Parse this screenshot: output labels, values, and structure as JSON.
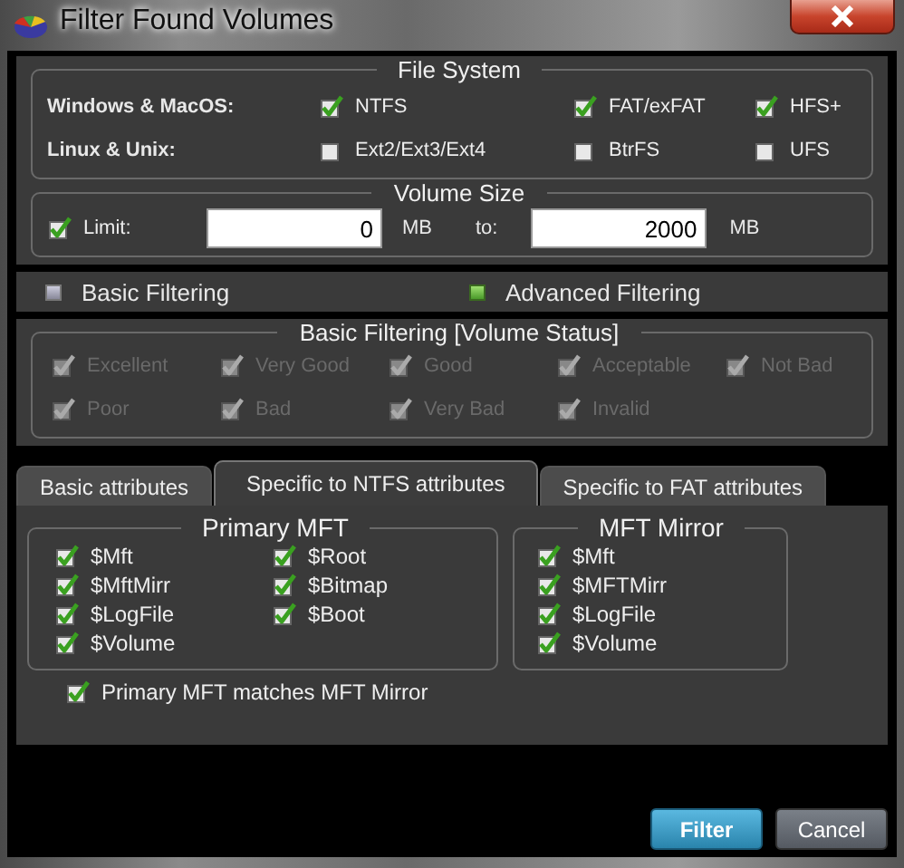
{
  "window": {
    "title": "Filter Found Volumes"
  },
  "file_system": {
    "title": "File System",
    "rows": [
      {
        "label": "Windows & MacOS:",
        "options": [
          {
            "label": "NTFS",
            "checked": true
          },
          {
            "label": "FAT/exFAT",
            "checked": true
          },
          {
            "label": "HFS+",
            "checked": true
          }
        ]
      },
      {
        "label": "Linux & Unix:",
        "options": [
          {
            "label": "Ext2/Ext3/Ext4",
            "checked": false
          },
          {
            "label": "BtrFS",
            "checked": false
          },
          {
            "label": "UFS",
            "checked": false
          }
        ]
      }
    ]
  },
  "volume_size": {
    "title": "Volume Size",
    "limit": {
      "label": "Limit:",
      "checked": true
    },
    "from": "0",
    "from_unit": "MB",
    "to_label": "to:",
    "to": "2000",
    "to_unit": "MB"
  },
  "filtering_modes": [
    {
      "label": "Basic Filtering",
      "selected": false
    },
    {
      "label": "Advanced Filtering",
      "selected": true
    }
  ],
  "basic_filtering": {
    "title": "Basic Filtering [Volume Status]",
    "disabled": true,
    "options": [
      {
        "label": "Excellent",
        "checked": true
      },
      {
        "label": "Very Good",
        "checked": true
      },
      {
        "label": "Good",
        "checked": true
      },
      {
        "label": "Acceptable",
        "checked": true
      },
      {
        "label": "Not Bad",
        "checked": true
      },
      {
        "label": "Poor",
        "checked": true
      },
      {
        "label": "Bad",
        "checked": true
      },
      {
        "label": "Very Bad",
        "checked": true
      },
      {
        "label": "Invalid",
        "checked": true
      }
    ]
  },
  "tabs": [
    {
      "label": "Basic attributes",
      "selected": false
    },
    {
      "label": "Specific to NTFS attributes",
      "selected": true
    },
    {
      "label": "Specific to FAT attributes",
      "selected": false
    }
  ],
  "primary_mft": {
    "title": "Primary MFT",
    "items": [
      {
        "label": "$Mft",
        "checked": true
      },
      {
        "label": "$MftMirr",
        "checked": true
      },
      {
        "label": "$LogFile",
        "checked": true
      },
      {
        "label": "$Volume",
        "checked": true
      },
      {
        "label": "$Root",
        "checked": true
      },
      {
        "label": "$Bitmap",
        "checked": true
      },
      {
        "label": "$Boot",
        "checked": true
      }
    ]
  },
  "mft_mirror": {
    "title": "MFT Mirror",
    "items": [
      {
        "label": "$Mft",
        "checked": true
      },
      {
        "label": "$MFTMirr",
        "checked": true
      },
      {
        "label": "$LogFile",
        "checked": true
      },
      {
        "label": "$Volume",
        "checked": true
      }
    ]
  },
  "match_option": {
    "label": "Primary MFT matches MFT Mirror",
    "checked": true
  },
  "buttons": [
    {
      "label": "Filter",
      "kind": "primary"
    },
    {
      "label": "Cancel",
      "kind": "secondary"
    }
  ]
}
